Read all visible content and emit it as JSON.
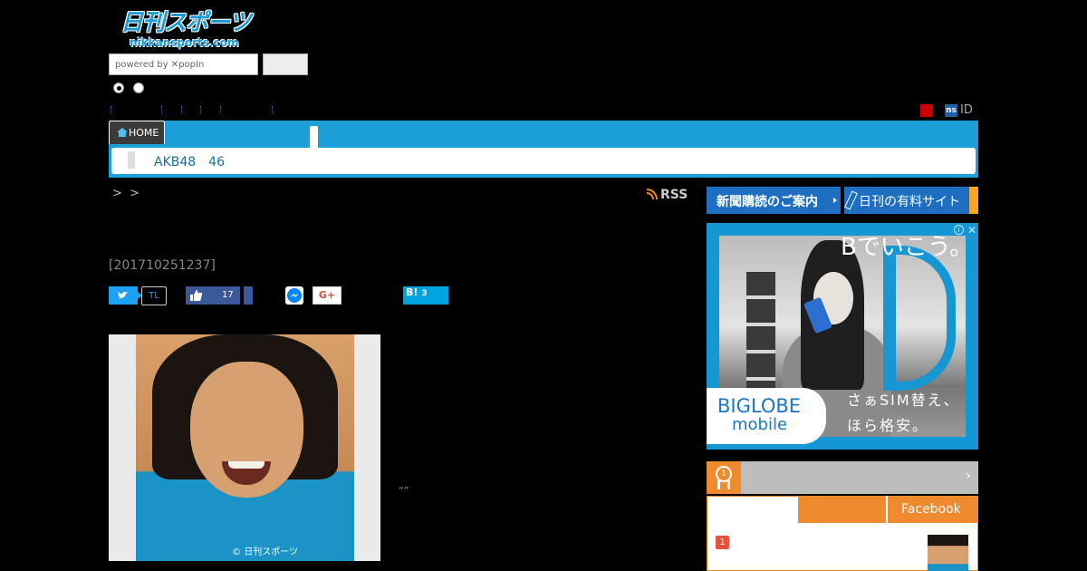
{
  "logo": {
    "main": "日刊スポーツ",
    "sub": "nikkansports.com"
  },
  "search": {
    "placeholder": "powered by ✕popIn",
    "button_label": ""
  },
  "utility": {
    "ns_badge": "ns",
    "id_label": "ID"
  },
  "nav": {
    "home_label": "HOME",
    "sub_item": "AKB48　46"
  },
  "breadcrumb": ">  >",
  "rss_label": "RSS",
  "article": {
    "timestamp": "[201710251237]",
    "photo_credit": "© 日刊スポーツ",
    "quote": "“”"
  },
  "share": {
    "tl_label": "TL",
    "fb_count": "17",
    "gplus_label": "G+",
    "hatena_label": "B!",
    "hatena_count": "3"
  },
  "sidebar": {
    "subscribe_label": "新聞購読のご案内",
    "paid_site_label": "日刊の有料サイト",
    "ad": {
      "headline": "Bでいこう。",
      "logo": "BIGLOBE",
      "logo_sub": "mobile",
      "copy_line1": "さぁSIM替え、",
      "copy_line2": "ほら格安。"
    },
    "ranking": {
      "chevron": "›",
      "facebook_tab": "Facebook",
      "first_rank": "1"
    }
  },
  "colors": {
    "brand_blue": "#1b9fd6",
    "accent_orange": "#f08a2e",
    "subscribe_blue": "#1e6fc1"
  }
}
